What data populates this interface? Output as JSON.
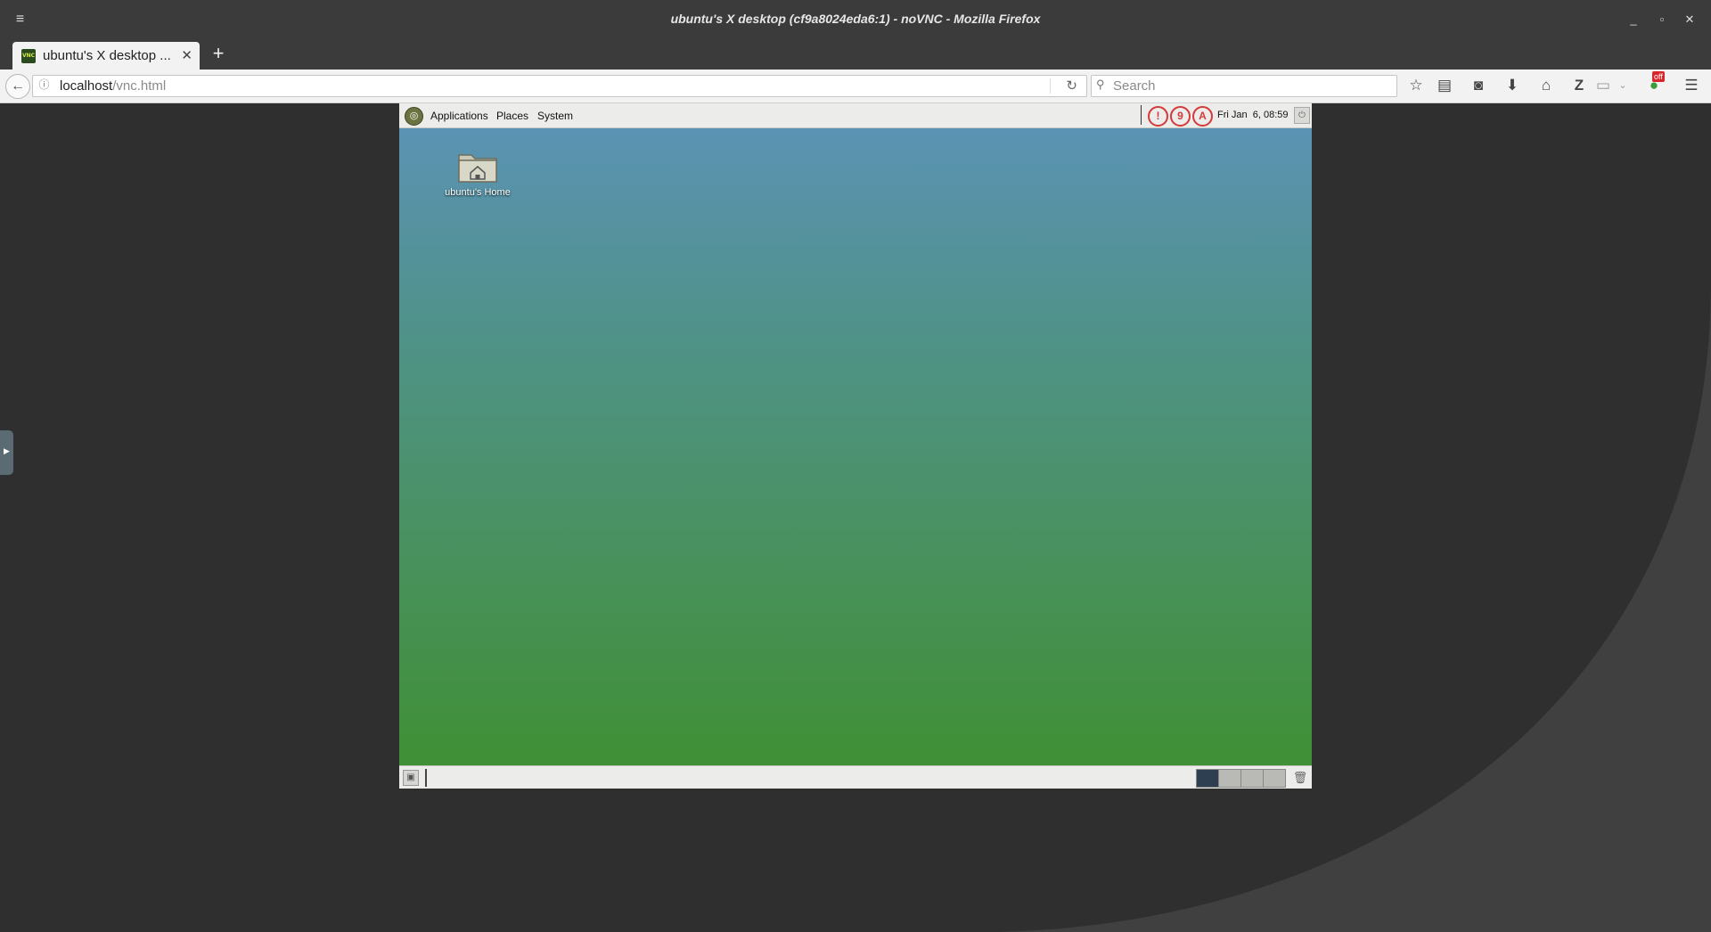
{
  "window": {
    "title": "ubuntu's X desktop (cf9a8024eda6:1) - noVNC - Mozilla Firefox",
    "menu_icon": "hamburger-icon",
    "controls": [
      "minimize-icon",
      "maximize-icon",
      "close-icon"
    ]
  },
  "tabs": [
    {
      "label": "ubuntu's X desktop ...",
      "favicon": "VNC"
    }
  ],
  "nav": {
    "url_host": "localhost",
    "url_path": "/vnc.html",
    "search_placeholder": "Search",
    "addon_badge": "off"
  },
  "desktop": {
    "menus": [
      "Applications",
      "Places",
      "System"
    ],
    "status_icons": [
      "!",
      "9",
      "A"
    ],
    "clock": "Fri Jan  6, 08:59",
    "home_icon_label": "ubuntu's Home",
    "workspaces": 4,
    "active_workspace": 1
  },
  "colors": {
    "desktop_top": "#5c93b9",
    "desktop_bottom": "#3e9031",
    "tray_alert": "#d43a3a"
  }
}
